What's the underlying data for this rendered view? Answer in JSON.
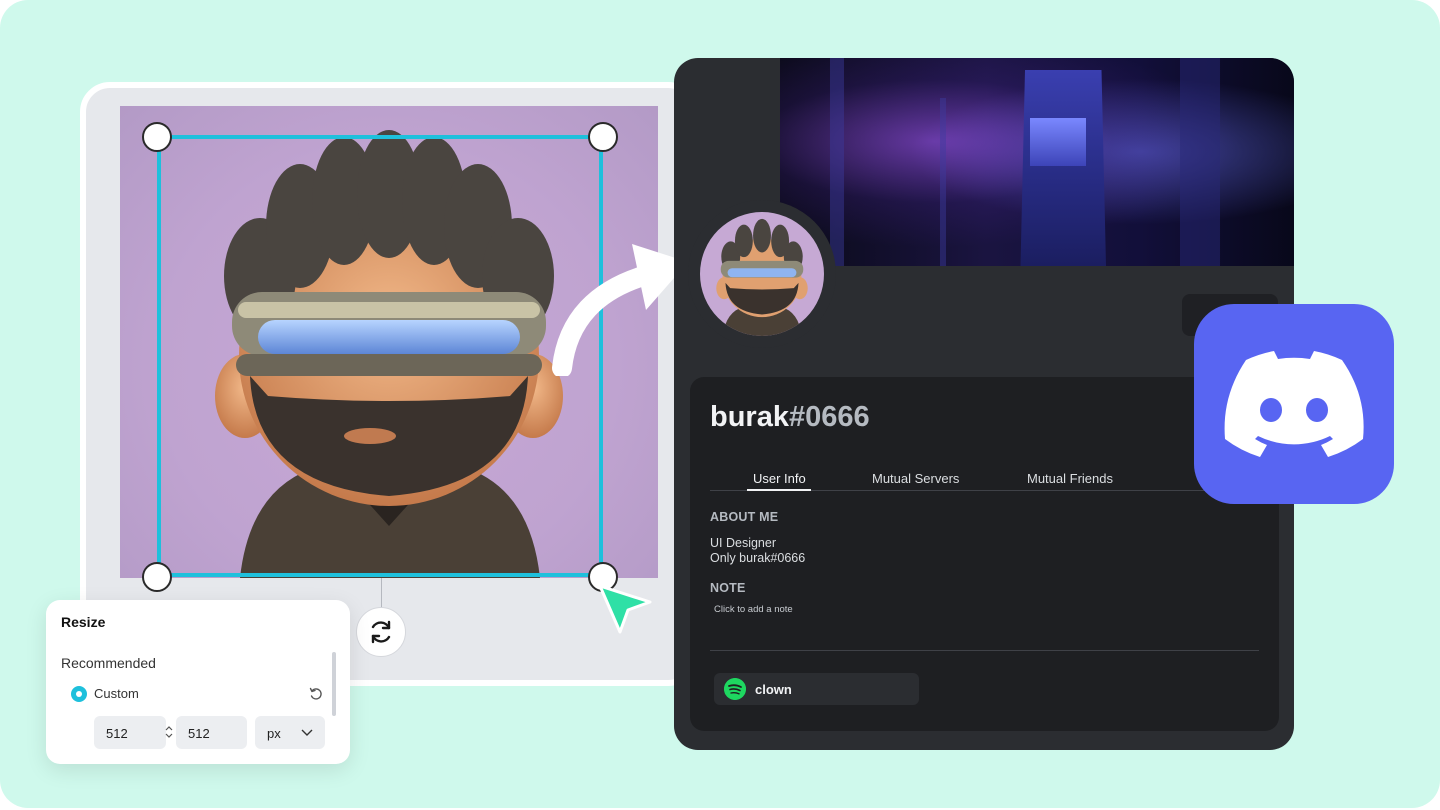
{
  "resize_panel": {
    "title": "Resize",
    "subtitle": "Recommended",
    "option_label": "Custom",
    "width_value": "512",
    "height_value": "512",
    "unit": "px"
  },
  "profile": {
    "username": "burak",
    "discriminator": "#0666",
    "tabs": [
      {
        "label": "User Info",
        "active": true
      },
      {
        "label": "Mutual Servers",
        "active": false
      },
      {
        "label": "Mutual Friends",
        "active": false
      }
    ],
    "about_title": "ABOUT ME",
    "about_lines": [
      "UI Designer",
      "Only burak#0666"
    ],
    "note_title": "NOTE",
    "note_placeholder": "Click to add a note",
    "connection_label": "clown"
  },
  "icons": {
    "rotate": "rotate-icon",
    "reset": "reset-icon",
    "stepper": "stepper-icon",
    "dropdown": "chevron-down-icon",
    "cursor": "cursor-pointer-icon",
    "arrow": "curved-arrow-icon",
    "spotify": "spotify-icon",
    "discord": "discord-logo-icon"
  },
  "colors": {
    "background": "#cff9ec",
    "crop_accent": "#1ec0dc",
    "cursor": "#2fe0a6",
    "discord_brand": "#5865f2",
    "card_bg": "#2b2d31",
    "spotify": "#1ed760"
  }
}
